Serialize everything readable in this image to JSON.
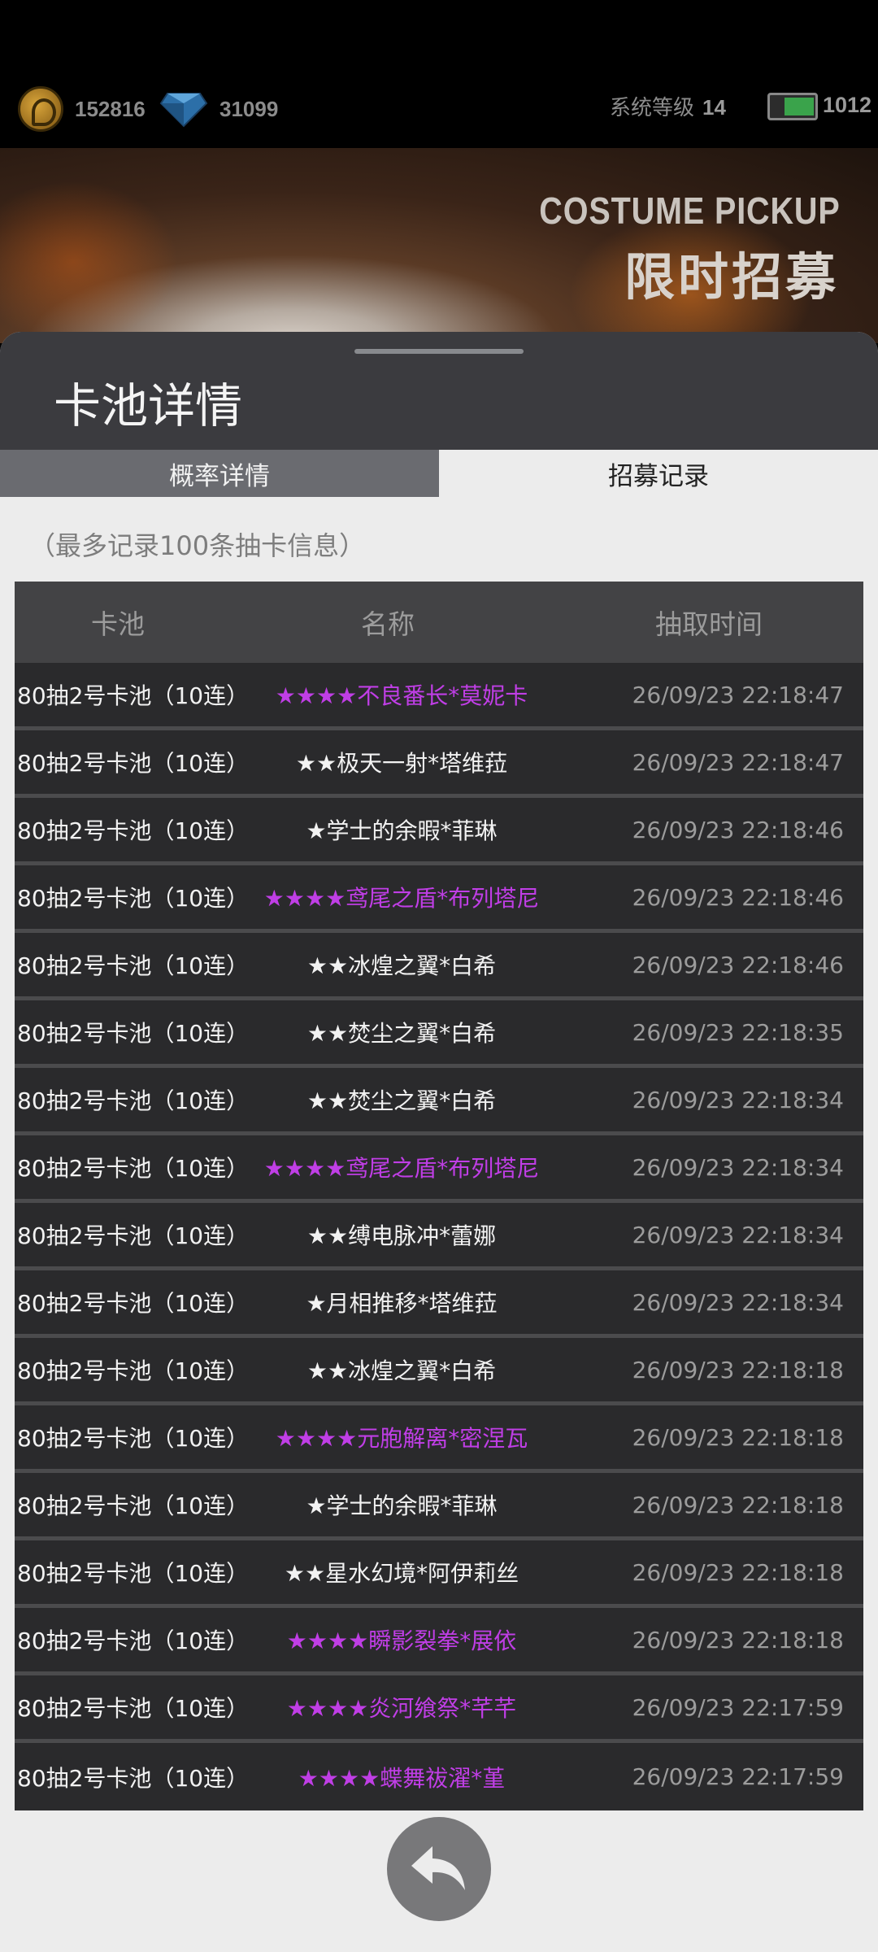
{
  "status": {
    "gold": "152816",
    "diamonds": "31099",
    "system_level_label": "系统等级",
    "system_level": "14",
    "stamina": "1012"
  },
  "banner": {
    "title_en": "COSTUME PICKUP",
    "title_cn": "限时招募"
  },
  "panel": {
    "title": "卡池详情",
    "tabs": [
      {
        "label": "概率详情",
        "active": false
      },
      {
        "label": "招募记录",
        "active": true
      }
    ],
    "note": "（最多记录100条抽卡信息）"
  },
  "table": {
    "headers": [
      "卡池",
      "名称",
      "抽取时间"
    ],
    "rows": [
      {
        "pool": "80抽2号卡池（10连）",
        "name": "★★★★不良番长*莫妮卡",
        "time": "26/09/23 22:18:47",
        "rarity": "purple"
      },
      {
        "pool": "80抽2号卡池（10连）",
        "name": "★★极天一射*塔维菈",
        "time": "26/09/23 22:18:47",
        "rarity": "white"
      },
      {
        "pool": "80抽2号卡池（10连）",
        "name": "★学士的余暇*菲琳",
        "time": "26/09/23 22:18:46",
        "rarity": "white"
      },
      {
        "pool": "80抽2号卡池（10连）",
        "name": "★★★★鸢尾之盾*布列塔尼",
        "time": "26/09/23 22:18:46",
        "rarity": "purple"
      },
      {
        "pool": "80抽2号卡池（10连）",
        "name": "★★冰煌之翼*白希",
        "time": "26/09/23 22:18:46",
        "rarity": "white"
      },
      {
        "pool": "80抽2号卡池（10连）",
        "name": "★★焚尘之翼*白希",
        "time": "26/09/23 22:18:35",
        "rarity": "white"
      },
      {
        "pool": "80抽2号卡池（10连）",
        "name": "★★焚尘之翼*白希",
        "time": "26/09/23 22:18:34",
        "rarity": "white"
      },
      {
        "pool": "80抽2号卡池（10连）",
        "name": "★★★★鸢尾之盾*布列塔尼",
        "time": "26/09/23 22:18:34",
        "rarity": "purple"
      },
      {
        "pool": "80抽2号卡池（10连）",
        "name": "★★缚电脉冲*蕾娜",
        "time": "26/09/23 22:18:34",
        "rarity": "white"
      },
      {
        "pool": "80抽2号卡池（10连）",
        "name": "★月相推移*塔维菈",
        "time": "26/09/23 22:18:34",
        "rarity": "white"
      },
      {
        "pool": "80抽2号卡池（10连）",
        "name": "★★冰煌之翼*白希",
        "time": "26/09/23 22:18:18",
        "rarity": "white"
      },
      {
        "pool": "80抽2号卡池（10连）",
        "name": "★★★★元胞解离*密涅瓦",
        "time": "26/09/23 22:18:18",
        "rarity": "purple"
      },
      {
        "pool": "80抽2号卡池（10连）",
        "name": "★学士的余暇*菲琳",
        "time": "26/09/23 22:18:18",
        "rarity": "white"
      },
      {
        "pool": "80抽2号卡池（10连）",
        "name": "★★星水幻境*阿伊莉丝",
        "time": "26/09/23 22:18:18",
        "rarity": "white"
      },
      {
        "pool": "80抽2号卡池（10连）",
        "name": "★★★★瞬影裂拳*展依",
        "time": "26/09/23 22:18:18",
        "rarity": "purple"
      },
      {
        "pool": "80抽2号卡池（10连）",
        "name": "★★★★炎河飨祭*芊芊",
        "time": "26/09/23 22:17:59",
        "rarity": "purple"
      },
      {
        "pool": "80抽2号卡池（10连）",
        "name": "★★★★蝶舞祓濯*堇",
        "time": "26/09/23 22:17:59",
        "rarity": "purple"
      }
    ]
  },
  "icons": {
    "gold": "coin-icon",
    "diamond": "diamond-icon",
    "stamina": "battery-icon",
    "back": "back-arrow-icon"
  },
  "colors": {
    "rare_text": "#c03ee6",
    "normal_text": "#f2f2f2",
    "time_text": "#9c9c9c"
  }
}
